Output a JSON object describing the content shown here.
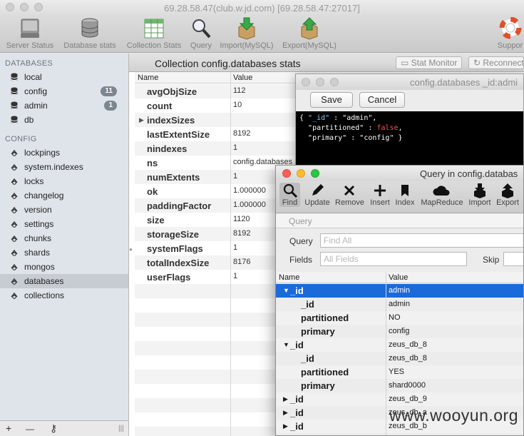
{
  "window": {
    "title": "69.28.58.47(club.w.jd.com) [69.28.58.47:27017]"
  },
  "toolbar": {
    "server_status": "Server Status",
    "database_stats": "Database stats",
    "collection_stats": "Collection Stats",
    "query": "Query",
    "import": "Import(MySQL)",
    "export": "Export(MySQL)",
    "support": "Suppor"
  },
  "sidebar": {
    "databases_header": "DATABASES",
    "databases": [
      {
        "label": "local",
        "badge": ""
      },
      {
        "label": "config",
        "badge": "11"
      },
      {
        "label": "admin",
        "badge": "1"
      },
      {
        "label": "db",
        "badge": ""
      }
    ],
    "config_header": "CONFIG",
    "collections": [
      "lockpings",
      "system.indexes",
      "locks",
      "changelog",
      "version",
      "settings",
      "chunks",
      "shards",
      "mongos",
      "databases",
      "collections"
    ],
    "bottom": {
      "add": "+",
      "remove": "—",
      "key": "⚷",
      "handle": "|||"
    }
  },
  "main": {
    "title": "Collection config.databases stats",
    "stat_monitor": "Stat Monitor",
    "reconnect": "Reconnect",
    "col_name": "Name",
    "col_value": "Value",
    "rows": [
      {
        "name": "avgObjSize",
        "value": "112"
      },
      {
        "name": "count",
        "value": "10"
      },
      {
        "name": "indexSizes",
        "value": ""
      },
      {
        "name": "lastExtentSize",
        "value": "8192"
      },
      {
        "name": "nindexes",
        "value": "1"
      },
      {
        "name": "ns",
        "value": "config.databases"
      },
      {
        "name": "numExtents",
        "value": "1"
      },
      {
        "name": "ok",
        "value": "1.000000"
      },
      {
        "name": "paddingFactor",
        "value": "1.000000"
      },
      {
        "name": "size",
        "value": "1120"
      },
      {
        "name": "storageSize",
        "value": "8192"
      },
      {
        "name": "systemFlags",
        "value": "1"
      },
      {
        "name": "totalIndexSize",
        "value": "8176"
      },
      {
        "name": "userFlags",
        "value": "1"
      }
    ]
  },
  "edit_window": {
    "title": "config.databases _id:admi",
    "save": "Save",
    "cancel": "Cancel",
    "code": {
      "l1_open": "{ ",
      "l1_key": "\"_id\"",
      "l1_rest": " : \"admin\",",
      "l2_indent": "  ",
      "l2_key": "\"partitioned\"",
      "l2_sep": " : ",
      "l2_val": "false",
      "l2_end": ",",
      "l3_indent": "  ",
      "l3_key": "\"primary\"",
      "l3_rest": " : \"config\" }"
    }
  },
  "query_window": {
    "title": "Query in config.databas",
    "toolbar": {
      "find": "Find",
      "update": "Update",
      "remove": "Remove",
      "insert": "Insert",
      "index": "Index",
      "mapreduce": "MapReduce",
      "import": "Import",
      "export": "Export"
    },
    "tab": "Query",
    "query_label": "Query",
    "query_placeholder": "Find All",
    "fields_label": "Fields",
    "fields_placeholder": "All Fields",
    "skip_label": "Skip",
    "col_name": "Name",
    "col_value": "Value",
    "rows": [
      {
        "name": "_id",
        "value": "admin",
        "level": 0,
        "tri": "▼"
      },
      {
        "name": "_id",
        "value": "admin",
        "level": 1,
        "tri": ""
      },
      {
        "name": "partitioned",
        "value": "NO",
        "level": 1,
        "tri": ""
      },
      {
        "name": "primary",
        "value": "config",
        "level": 1,
        "tri": ""
      },
      {
        "name": "_id",
        "value": "zeus_db_8",
        "level": 0,
        "tri": "▼"
      },
      {
        "name": "_id",
        "value": "zeus_db_8",
        "level": 1,
        "tri": ""
      },
      {
        "name": "partitioned",
        "value": "YES",
        "level": 1,
        "tri": ""
      },
      {
        "name": "primary",
        "value": "shard0000",
        "level": 1,
        "tri": ""
      },
      {
        "name": "_id",
        "value": "zeus_db_9",
        "level": 0,
        "tri": "▶"
      },
      {
        "name": "_id",
        "value": "zeus_db_a",
        "level": 0,
        "tri": "▶"
      },
      {
        "name": "_id",
        "value": "zeus_db_b",
        "level": 0,
        "tri": "▶"
      }
    ]
  },
  "watermark": "www.wooyun.org"
}
